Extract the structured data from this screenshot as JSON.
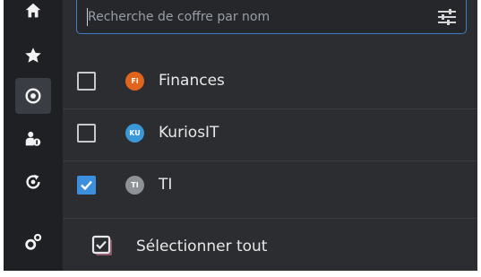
{
  "search": {
    "placeholder": "Recherche de coffre par nom",
    "value": ""
  },
  "sidebar": {
    "items": [
      {
        "icon": "home-icon",
        "active": false
      },
      {
        "icon": "star-icon",
        "active": false
      },
      {
        "icon": "vault-icon",
        "active": true
      },
      {
        "icon": "users-icon",
        "active": false
      },
      {
        "icon": "refresh-icon",
        "active": false
      },
      {
        "icon": "settings-icon",
        "active": false
      }
    ]
  },
  "vaults": [
    {
      "name": "Finances",
      "initials": "Fi",
      "color": "#e0641c",
      "checked": false
    },
    {
      "name": "KuriosIT",
      "initials": "KU",
      "color": "#3a97d9",
      "checked": false
    },
    {
      "name": "TI",
      "initials": "TI",
      "color": "#8e9296",
      "checked": true
    }
  ],
  "footer": {
    "select_all_label": "Sélectionner tout"
  },
  "colors": {
    "accent": "#3b8fdd",
    "background": "#2b2d31",
    "sidebar": "#1e2024"
  }
}
